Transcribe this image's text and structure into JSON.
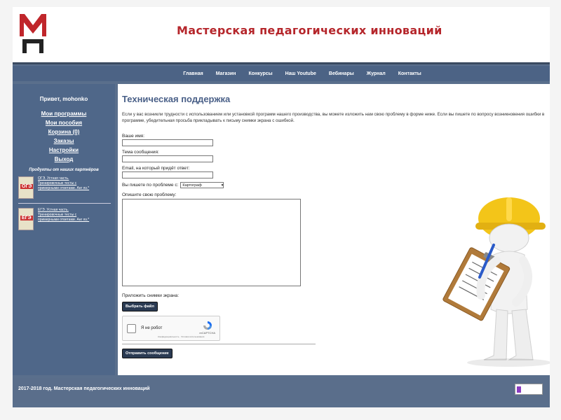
{
  "site": {
    "title": "Мастерская педагогических инноваций",
    "logo_text": "МП"
  },
  "nav": {
    "items": [
      "Главная",
      "Магазин",
      "Конкурсы",
      "Наш Youtube",
      "Вебинары",
      "Журнал",
      "Контакты"
    ]
  },
  "sidebar": {
    "greeting": "Привет, mohonko",
    "menu": [
      "Мои программы",
      "Мои пособия",
      "Корзина (0)",
      "Заказы",
      "Настройки",
      "Выход"
    ],
    "partners_title": "Продукты от наших партнёров",
    "products": [
      {
        "badge": "ОГЭ",
        "label": "ОГЭ. Устная часть. Тренировочные тесты с примерными ответами. Анг яз.*"
      },
      {
        "badge": "ЕГЭ",
        "label": "ЕГЭ. Устная часть. Тренировочные тесты с примерными ответами. Анг яз.*"
      }
    ]
  },
  "main": {
    "heading": "Техническая поддержка",
    "intro": "Если у вас возникли трудности с использованием или установкой программ нашего производства, вы можете изложить нам свою проблему в форме ниже. Если вы пишете по вопросу возникновения ошибки в программе, убедительная просьба прикладывать к письму снимки экрана с ошибкой.",
    "fields": {
      "name_label": "Ваше имя:",
      "subject_label": "Тема сообщения:",
      "email_label": "Email, на который придёт ответ:",
      "problem_label": "Вы пишете по проблеме с:",
      "problem_selected": "Картограф",
      "describe_label": "Опишите свою проблему:",
      "attach_label": "Приложить снимки экрана:"
    },
    "choose_file_button": "Выбрать файл",
    "captcha": {
      "label": "Я не робот",
      "brand": "reCAPTCHA",
      "fine_print": "Конфиденциальность · Условия использования"
    },
    "submit_button": "Отправить сообщение"
  },
  "footer": {
    "text": "2017-2018 год. Мастерская педагогических инноваций"
  },
  "colors": {
    "title_red": "#b5262b",
    "nav_blue": "#4c6385",
    "heading_blue": "#4a6088",
    "helmet_yellow": "#f3c519"
  }
}
